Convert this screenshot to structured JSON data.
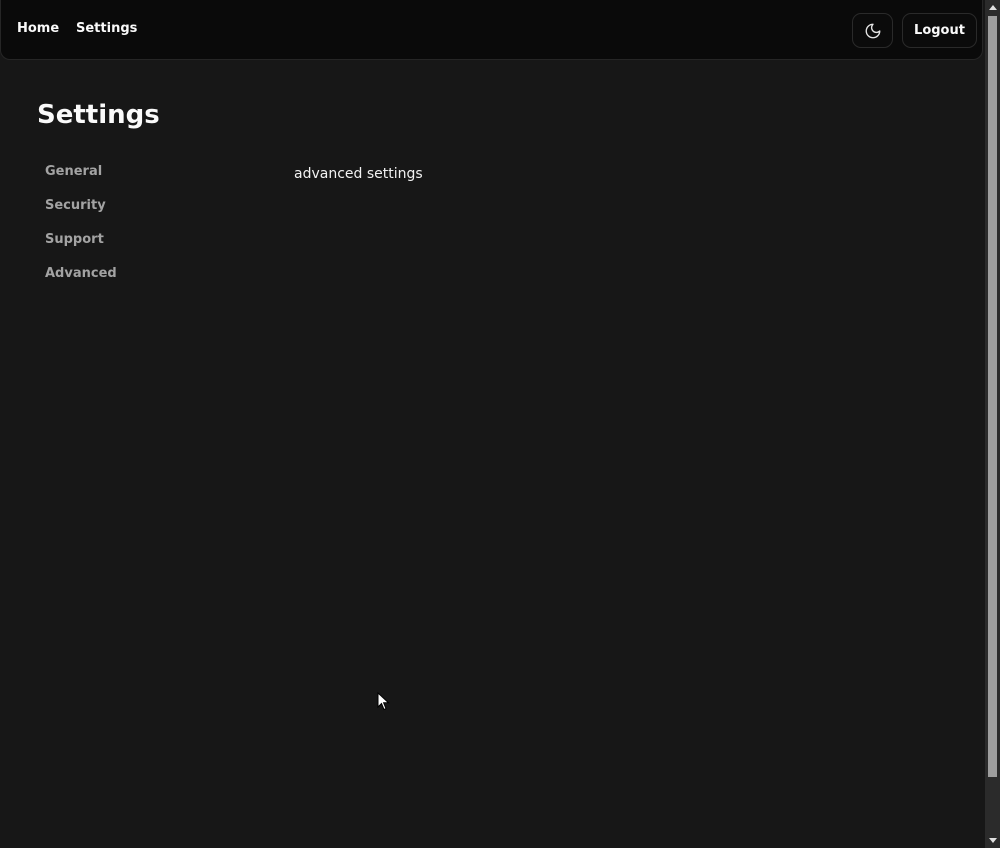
{
  "navbar": {
    "home_label": "Home",
    "settings_label": "Settings",
    "theme_toggle_icon": "moon-icon",
    "logout_label": "Logout"
  },
  "page": {
    "title": "Settings"
  },
  "sidebar": {
    "items": [
      {
        "label": "General"
      },
      {
        "label": "Security"
      },
      {
        "label": "Support"
      },
      {
        "label": "Advanced"
      }
    ]
  },
  "main": {
    "content_text": "advanced settings"
  },
  "colors": {
    "background": "#171717",
    "navbar_background": "#0a0a0a",
    "text_primary": "#fafafa",
    "text_muted": "#a3a3a3",
    "border": "#262626"
  }
}
